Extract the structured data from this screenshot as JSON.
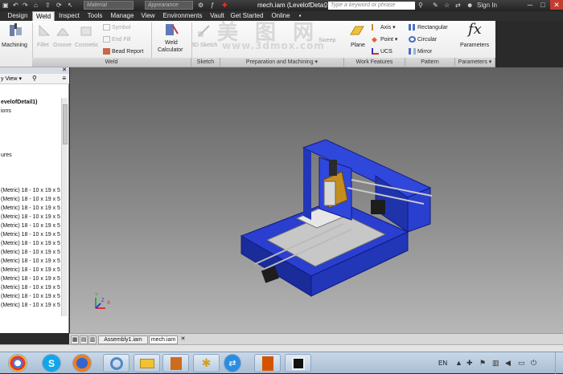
{
  "titlebar": {
    "material_combo": "Material",
    "appearance_combo": "Appearance",
    "doc_title": "mech.iam (LevelofDeta...",
    "search_placeholder": "Type a keyword or phrase",
    "sign_in": "Sign In"
  },
  "tabs": [
    "Design",
    "Weld",
    "Inspect",
    "Tools",
    "Manage",
    "View",
    "Environments",
    "Vault",
    "Get Started",
    "Online"
  ],
  "active_tab": "Weld",
  "ribbon": {
    "machining": "Machining",
    "fillet": "Fillet",
    "groove": "Groove",
    "cosmetic": "Cosmetic",
    "symbol": "Symbol",
    "end_fill": "End Fill",
    "bead_report": "Bead Report",
    "weld_calc_line1": "Weld",
    "weld_calc_line2": "Calculator",
    "sketch_3d": "3D Sketch",
    "sweep": "Sweep",
    "plane": "Plane",
    "axis": "Axis",
    "point": "Point",
    "ucs": "UCS",
    "rectangular": "Rectangular",
    "circular": "Circular",
    "mirror": "Mirror",
    "fx": "fx",
    "parameters": "Parameters",
    "panels": {
      "weld": "Weld",
      "sketch": "Sketch",
      "prep": "Preparation and Machining",
      "work": "Work Features",
      "pattern": "Pattern",
      "params": "Parameters"
    }
  },
  "browser": {
    "view_selector": "y View",
    "tree": [
      "evelofDetail1)",
      "ions",
      "",
      "",
      "",
      "",
      "ures",
      "",
      "",
      "",
      "(Metric) 18 - 10 x 19 x 5",
      "(Metric) 18 - 10 x 19 x 5",
      "(Metric) 18 - 10 x 19 x 5",
      "(Metric) 18 - 10 x 19 x 5",
      "(Metric) 18 - 10 x 19 x 5",
      "(Metric) 18 - 10 x 19 x 5",
      "(Metric) 18 - 10 x 19 x 5",
      "(Metric) 18 - 10 x 19 x 5",
      "(Metric) 18 - 10 x 19 x 5",
      "(Metric) 18 - 10 x 19 x 5",
      "(Metric) 18 - 10 x 19 x 5",
      "(Metric) 18 - 10 x 19 x 5",
      "(Metric) 18 - 10 x 19 x 5",
      "(Metric) 18 - 10 x 19 x 5"
    ]
  },
  "triad": {
    "x": "X",
    "y": "Y",
    "z": "Z"
  },
  "doc_tabs": [
    "Assembly1.iam",
    "mech.iam"
  ],
  "active_doc": "mech.iam",
  "watermark": "www.3dmox.com",
  "taskbar": {
    "lang": "EN"
  },
  "colors": {
    "accent_blue": "#2b3fd6",
    "ribbon_bg": "#f2f2f2",
    "viewport_top": "#606060"
  }
}
